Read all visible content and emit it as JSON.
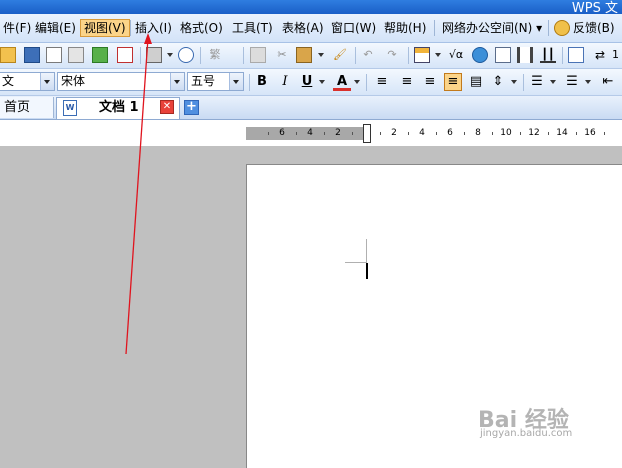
{
  "window": {
    "title": "WPS 文"
  },
  "menubar": {
    "items": [
      {
        "label": "件(F)"
      },
      {
        "label": "编辑(E)"
      },
      {
        "label": "视图(V)"
      },
      {
        "label": "插入(I)"
      },
      {
        "label": "格式(O)"
      },
      {
        "label": "工具(T)"
      },
      {
        "label": "表格(A)"
      },
      {
        "label": "窗口(W)"
      },
      {
        "label": "帮助(H)"
      },
      {
        "label": "网络办公空间(N) ▾"
      },
      {
        "label": "反馈(B)"
      }
    ],
    "active_item": "视图(V)"
  },
  "toolbar": {
    "icons": [
      "open-folder-icon",
      "save-icon",
      "print-preview-icon",
      "permissions-icon",
      "send-mail-icon",
      "export-pdf-icon",
      "print-icon",
      "find-icon",
      "chinese-convert-icon",
      "copy-icon",
      "cut-icon",
      "paste-icon",
      "format-painter-icon",
      "undo-icon",
      "redo-icon",
      "insert-table-icon",
      "formula-icon",
      "hyperlink-icon",
      "columns-icon",
      "document-map-icon",
      "paragraph-mark-icon"
    ],
    "formula_glyph": "√α",
    "zoom_partial": "1"
  },
  "format_bar": {
    "style_value": "文",
    "font_value": "宋体",
    "size_value": "五号",
    "bold_label": "B",
    "italic_label": "I",
    "underline_label": "U",
    "font_color_label": "A",
    "accent_color": "#fbd489"
  },
  "tabs": {
    "home_label": "首页",
    "doc_label": "文档 1",
    "doc_icon_text": "W",
    "close_glyph": "✕",
    "new_glyph": "+"
  },
  "ruler": {
    "left_numbers": [
      "6",
      "4",
      "2"
    ],
    "right_numbers": [
      "2",
      "4",
      "6",
      "8",
      "10",
      "12",
      "14",
      "16"
    ]
  },
  "watermark": {
    "main": "Bai 经验",
    "sub": "jingyan.baidu.com"
  },
  "annotation": {
    "arrow_color": "#e0141e"
  }
}
